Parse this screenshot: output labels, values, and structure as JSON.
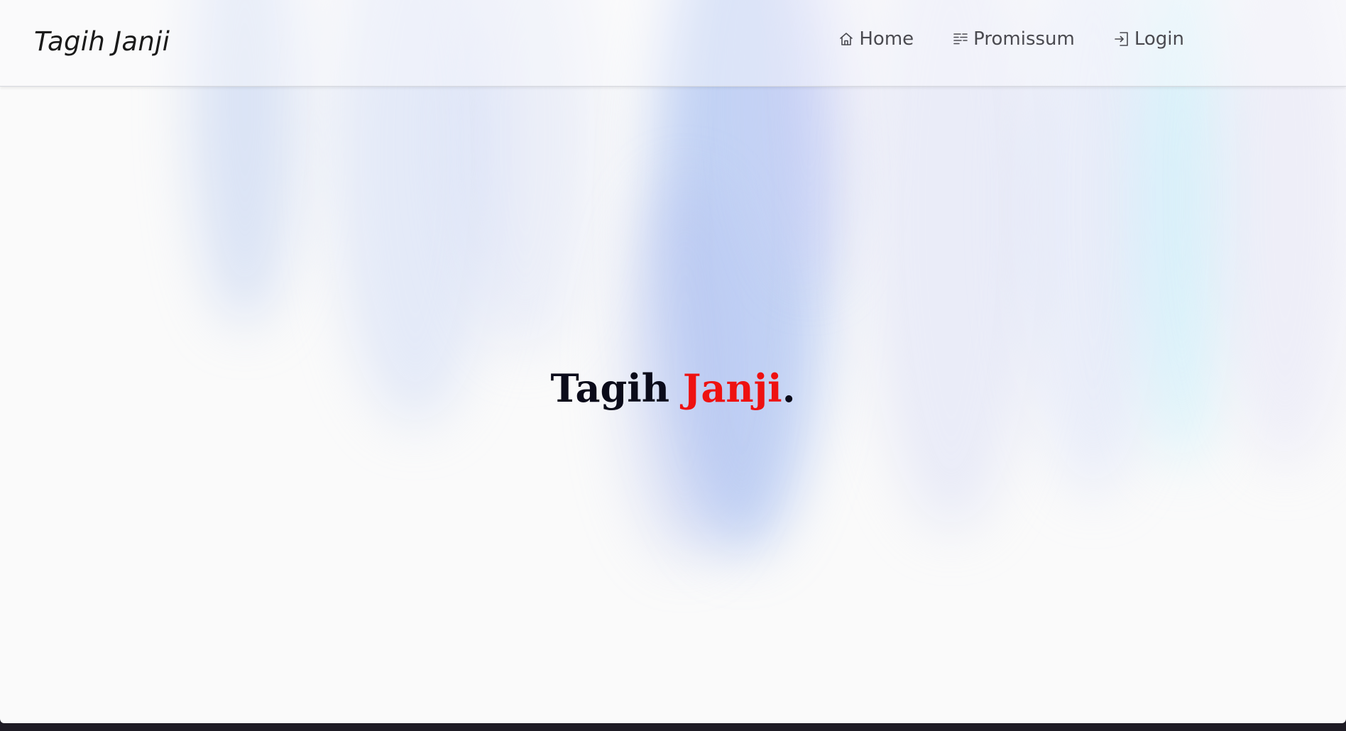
{
  "navbar": {
    "brand": "Tagih Janji",
    "items": [
      {
        "label": "Home",
        "icon": "home-icon"
      },
      {
        "label": "Promissum",
        "icon": "list-icon"
      },
      {
        "label": "Login",
        "icon": "login-icon"
      }
    ]
  },
  "hero": {
    "word1": "Tagih",
    "word2": "Janji",
    "punct": "."
  },
  "colors": {
    "accent": "#ee1111",
    "heading": "#0b0b1a",
    "nav_text": "#4a4a50",
    "background": "#fafafa"
  }
}
